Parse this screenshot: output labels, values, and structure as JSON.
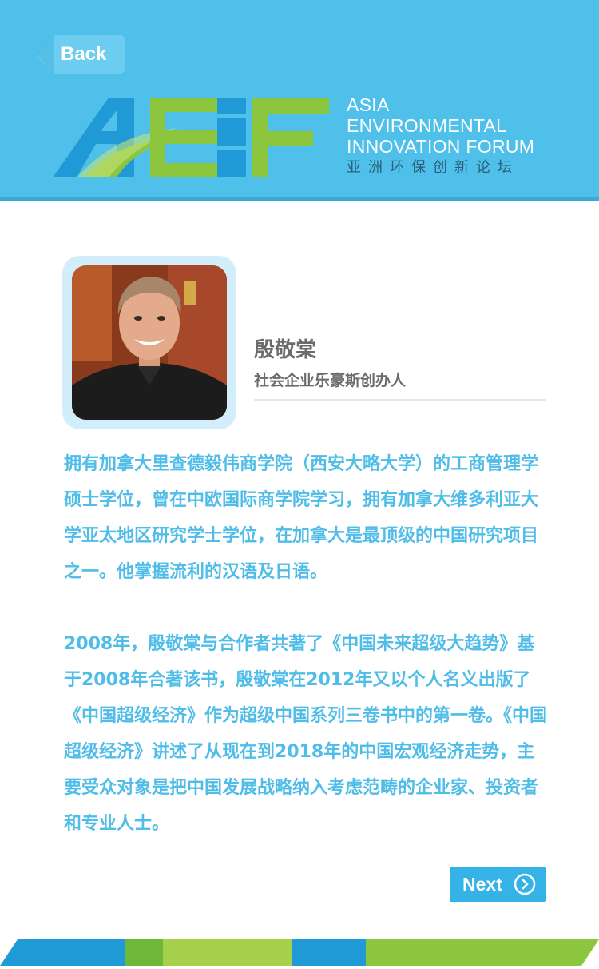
{
  "nav": {
    "back_label": "Back",
    "next_label": "Next"
  },
  "logo": {
    "mark": "AEIF",
    "lines": [
      "ASIA",
      "ENVIRONMENTAL",
      "INNOVATION FORUM"
    ],
    "chinese": "亚洲环保创新论坛"
  },
  "profile": {
    "name": "殷敬棠",
    "title": "社会企业乐豪斯创办人"
  },
  "bio": {
    "paragraph1": "拥有加拿大里查德毅伟商学院（西安大略大学）的工商管理学硕士学位，曾在中欧国际商学院学习，拥有加拿大维多利亚大学亚太地区研究学士学位，在加拿大是最顶级的中国研究项目之一。他掌握流利的汉语及日语。",
    "paragraph2": "2008年，殷敬棠与合作者共著了《中国未来超级大趋势》基于2008年合著该书，殷敬棠在2012年又以个人名义出版了《中国超级经济》作为超级中国系列三卷书中的第一卷。《中国超级经济》讲述了从现在到2018年的中国宏观经济走势，主要受众对象是把中国发展战略纳入考虑范畴的企业家、投资者和专业人士。"
  },
  "icons": {
    "back": "back-arrow-icon",
    "next": "chevron-right-circle-icon"
  },
  "colors": {
    "header": "#4fc0ea",
    "text_accent": "#4fbde8",
    "button": "#35b2e6",
    "green": "#8cc63f",
    "blue": "#1f9ad6"
  }
}
